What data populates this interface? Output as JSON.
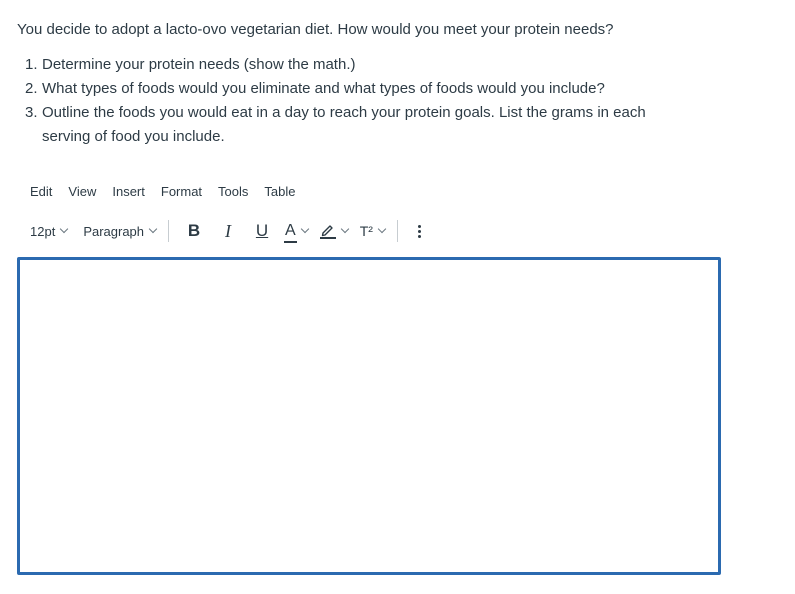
{
  "question": {
    "intro": "You decide to adopt a lacto-ovo vegetarian diet.  How would you meet your protein needs?",
    "items": [
      {
        "num": "1.",
        "text": "Determine your protein needs (show the math.)"
      },
      {
        "num": "2.",
        "text": "What types of foods would you eliminate and what types of foods would you include?"
      },
      {
        "num": "3.",
        "text": "Outline the foods you would eat in a day to reach your protein goals. List the grams in each serving of food you include."
      }
    ]
  },
  "menubar": {
    "items": [
      "Edit",
      "View",
      "Insert",
      "Format",
      "Tools",
      "Table"
    ]
  },
  "toolbar": {
    "font_size": "12pt",
    "block_format": "Paragraph",
    "bold": "B",
    "italic": "I",
    "underline": "U",
    "text_color": "A",
    "superscript": "T²",
    "icons": {
      "font_size_chevron": "chevron-down-icon",
      "paragraph_chevron": "chevron-down-icon",
      "text_color": "text-color-icon",
      "highlight": "highlight-pen-icon",
      "superscript": "superscript-icon",
      "more": "more-vertical-icon"
    }
  },
  "editor": {
    "value": ""
  },
  "colors": {
    "text": "#2d3b45",
    "focus_border": "#2b6ab0",
    "separator": "#c7cdd1"
  }
}
